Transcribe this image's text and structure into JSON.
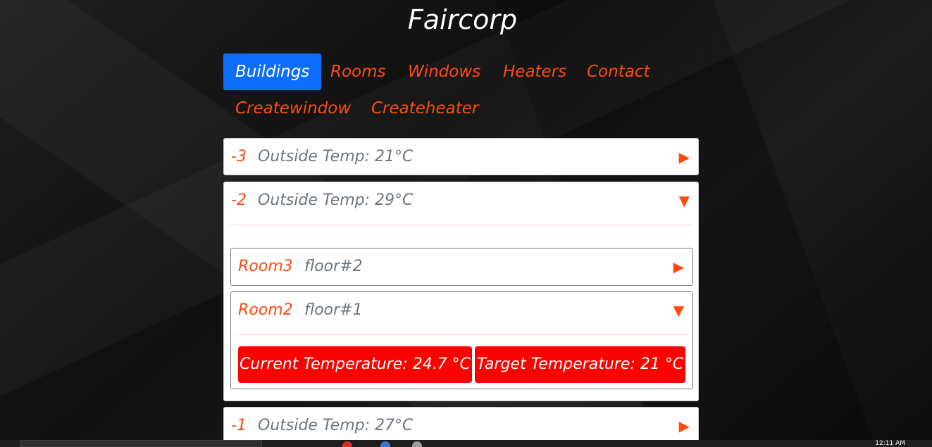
{
  "header": {
    "title": "Faircorp"
  },
  "nav": {
    "items": [
      {
        "label": "Buildings",
        "active": true
      },
      {
        "label": "Rooms"
      },
      {
        "label": "Windows"
      },
      {
        "label": "Heaters"
      },
      {
        "label": "Contact"
      },
      {
        "label": "Createwindow"
      },
      {
        "label": "Createheater"
      }
    ]
  },
  "floors": [
    {
      "number": "-3",
      "temp_label": "Outside Temp: 21°C",
      "expanded": false,
      "arrow": "▶"
    },
    {
      "number": "-2",
      "temp_label": "Outside Temp: 29°C",
      "expanded": true,
      "arrow": "▼",
      "rooms": [
        {
          "name": "Room3",
          "floor": "floor#2",
          "expanded": false,
          "arrow": "▶"
        },
        {
          "name": "Room2",
          "floor": "floor#1",
          "expanded": true,
          "arrow": "▼",
          "current_temperature": "Current Temperature: 24.7 °C",
          "target_temperature": "Target Temperature: 21 °C"
        }
      ]
    },
    {
      "number": "-1",
      "temp_label": "Outside Temp: 27°C",
      "expanded": false,
      "arrow": "▶"
    }
  ],
  "taskbar": {
    "clock": "12:11 AM"
  },
  "colors": {
    "accent": "#ff4a0f",
    "active_nav": "#0d6efd",
    "temperature_badge": "#ff0000",
    "muted_text": "#6c757d"
  }
}
